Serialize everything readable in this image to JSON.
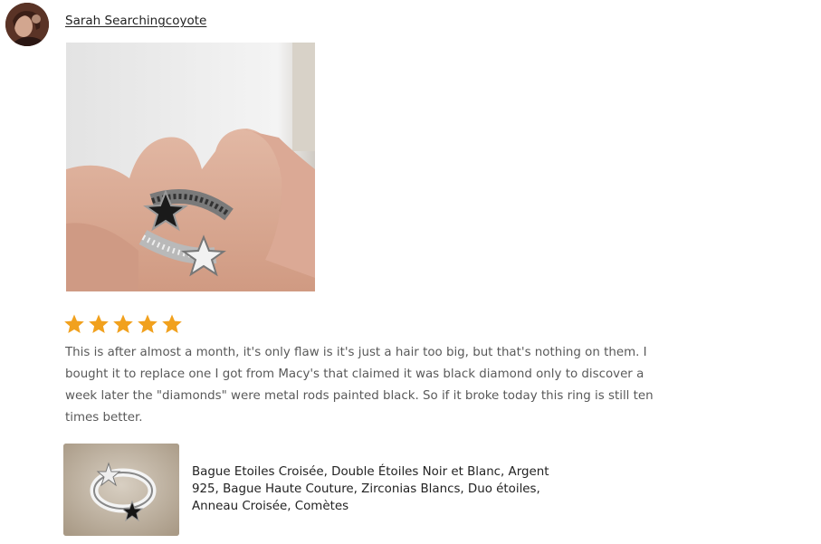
{
  "review": {
    "reviewer_name": "Sarah Searchingcoyote",
    "rating": 5,
    "rating_max": 5,
    "text": "This is after almost a month, it's only flaw is it's just a hair too big, but that's nothing on them. I bought it to replace one I got from Macy's that claimed it was black diamond only to discover a week later the \"diamonds\" were metal rods painted black. So if it broke today this ring is still ten times better."
  },
  "product": {
    "title": "Bague Etoiles Croisée, Double Étoiles Noir et Blanc, Argent 925, Bague Haute Couture, Zirconias Blancs, Duo étoiles, Anneau Croisée, Comètes"
  },
  "colors": {
    "star": "#f1a11e",
    "text_muted": "#595959",
    "text_main": "#222222"
  }
}
